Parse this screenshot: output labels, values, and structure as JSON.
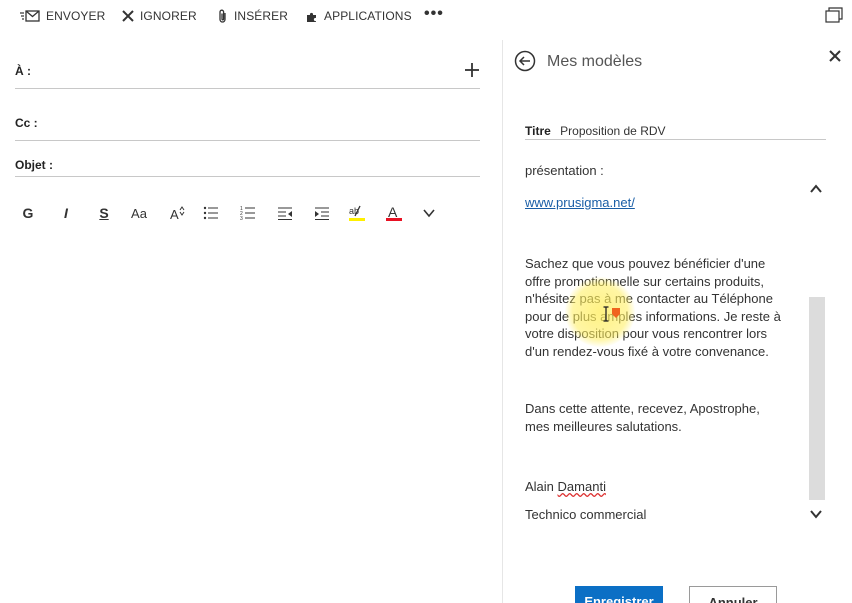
{
  "toolbar": {
    "send_label": "ENVOYER",
    "ignore_label": "IGNORER",
    "insert_label": "INSÉRER",
    "apps_label": "APPLICATIONS",
    "more_label": "•••"
  },
  "compose": {
    "to_label": "À :",
    "cc_label": "Cc :",
    "subject_label": "Objet :",
    "format_buttons": [
      "G",
      "I",
      "S",
      "Aa"
    ]
  },
  "templates": {
    "title": "Mes modèles",
    "title_field_label": "Titre",
    "title_field_value": "Proposition de RDV",
    "body": {
      "line1": "présentation :",
      "link": "www.prusigma.net/",
      "p1": [
        "Sachez que vous pouvez bénéficier d'une",
        "offre promotionnelle sur certains produits,",
        "n'hésitez pas à me contacter au Téléphone",
        "pour de plus amples informations. Je reste à",
        "votre disposition pour vous rencontrer lors",
        "d'un rendez-vous fixé à votre convenance."
      ],
      "p2": [
        "Dans cette attente, recevez, Apostrophe,",
        "mes meilleures salutations."
      ],
      "sign_first": "Alain",
      "sign_last": "Damanti",
      "sign_role": "Technico commercial"
    },
    "save_label": "Enregistrer",
    "cancel_label": "Annuler"
  },
  "colors": {
    "primary_button": "#0b6fc5",
    "link": "#1a5ea6",
    "highlight_color": "#fff000",
    "font_color_swatch": "#e81123"
  }
}
